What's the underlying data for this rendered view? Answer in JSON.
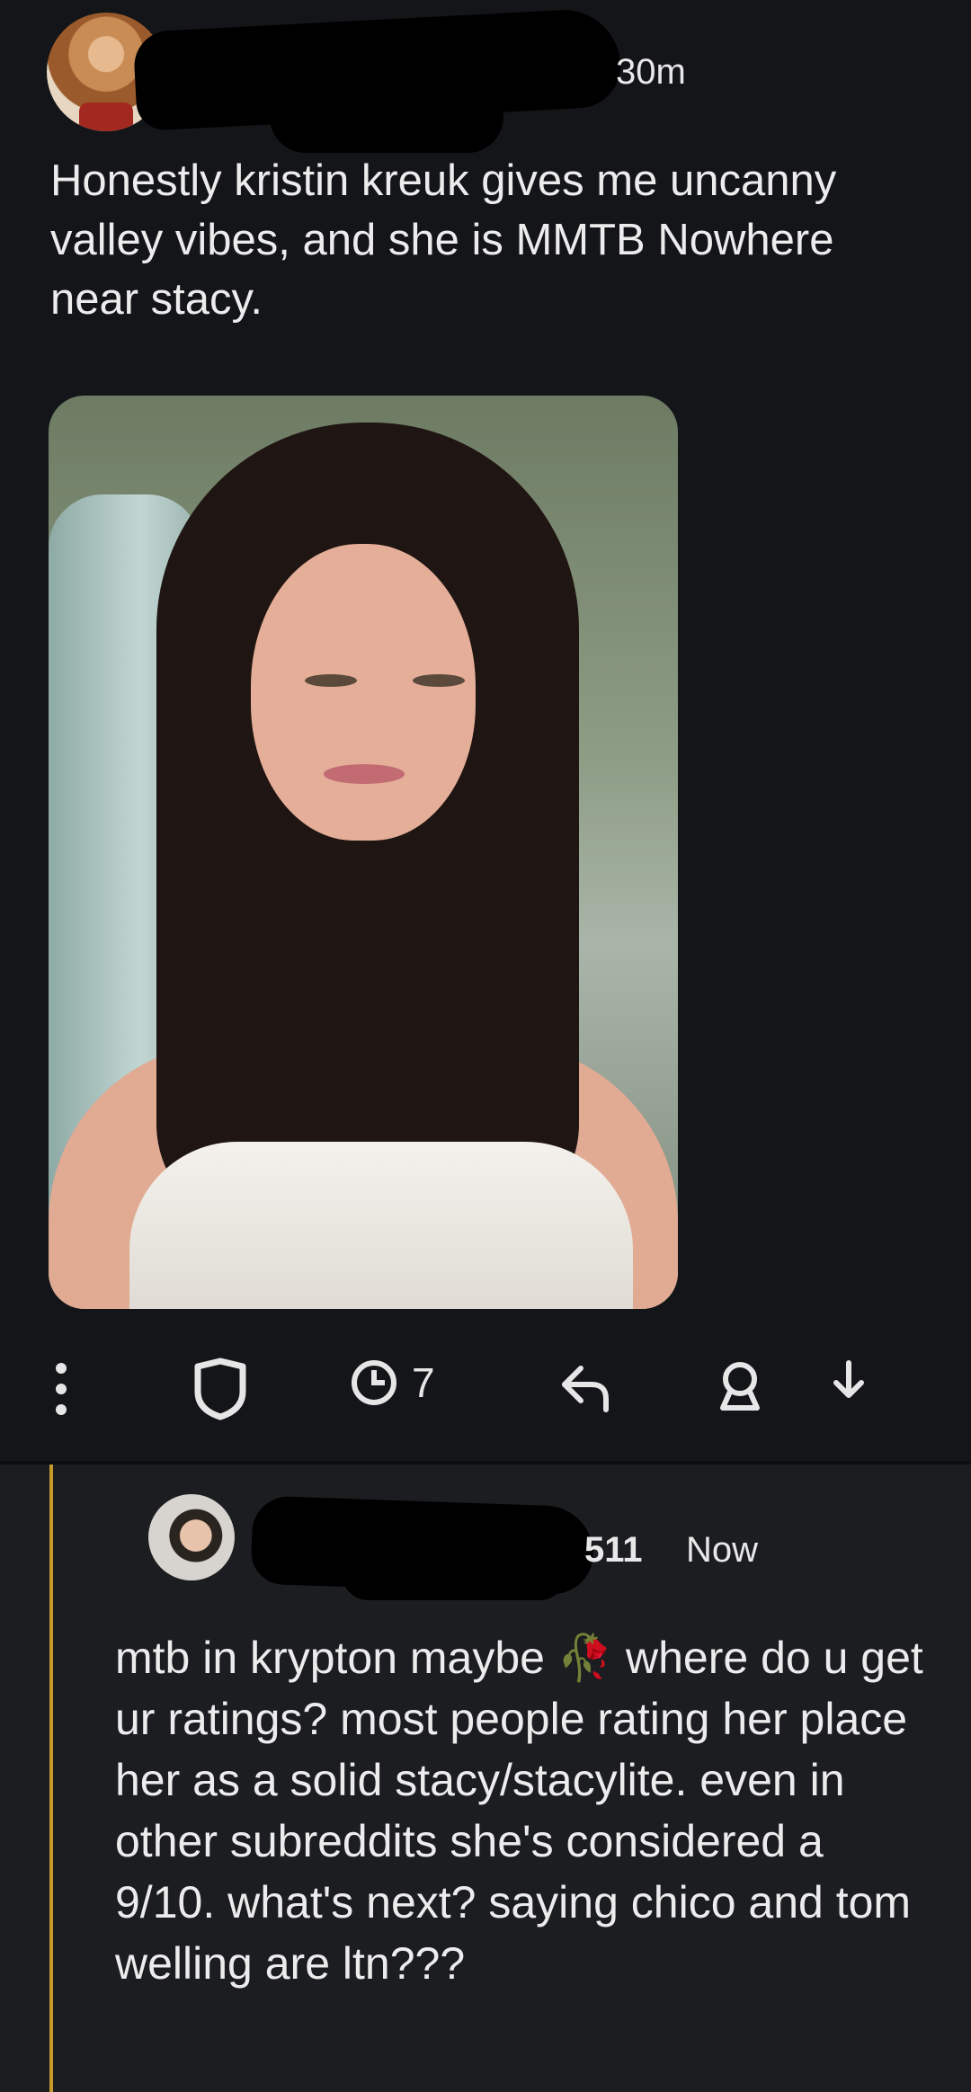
{
  "post": {
    "time": "30m",
    "body": "Honestly kristin kreuk gives me uncanny valley vibes, and she is MMTB Nowhere near stacy.",
    "actions": {
      "more_icon": "more-vertical-icon",
      "shield_icon": "shield-icon",
      "award_count": "7",
      "reply_icon": "reply-icon",
      "share_icon": "share-icon",
      "download_icon": "download-icon"
    }
  },
  "reply": {
    "username_suffix": "511",
    "time": "Now",
    "body": "mtb in krypton maybe 🥀 where do u get ur ratings? most people rating her place her as a solid stacy/stacylite. even in other subreddits she's considered a 9/10. what's next? saying chico and tom welling are ltn???"
  },
  "colors": {
    "thread_line": "#c89a2c",
    "background": "#141518"
  }
}
